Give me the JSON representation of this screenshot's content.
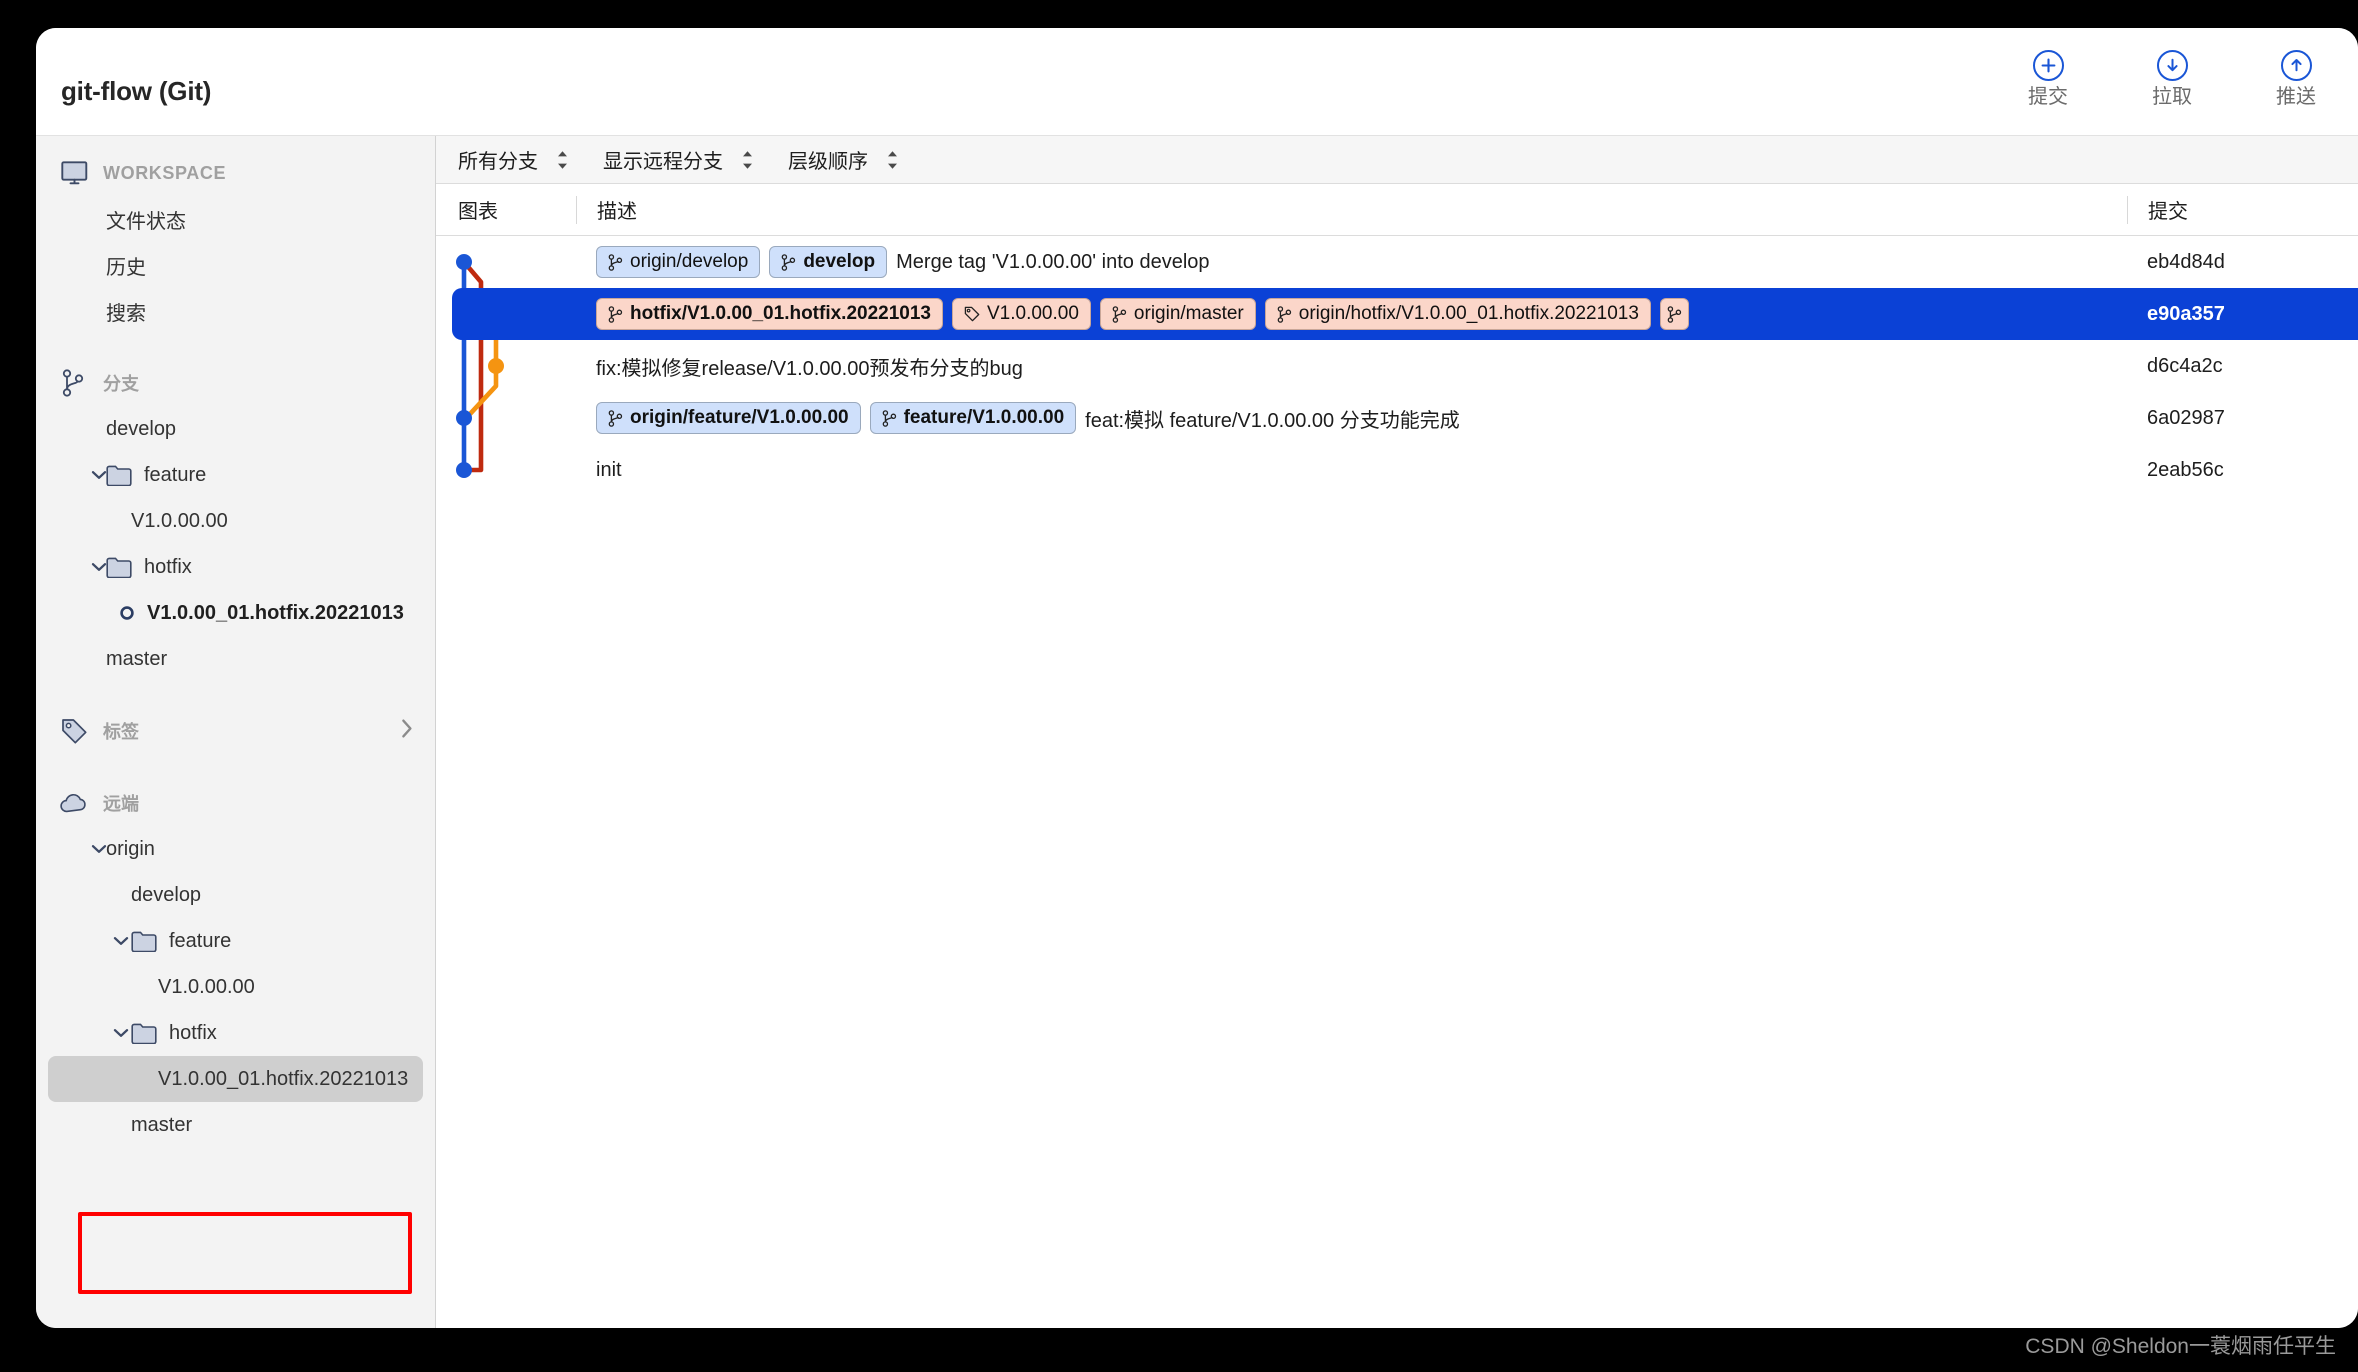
{
  "window": {
    "title": "git-flow (Git)"
  },
  "toolbar": {
    "buttons": [
      {
        "label": "提交",
        "icon": "plus-circle-icon"
      },
      {
        "label": "拉取",
        "icon": "download-circle-icon"
      },
      {
        "label": "推送",
        "icon": "upload-circle-icon"
      }
    ]
  },
  "sidebar": {
    "sections": [
      {
        "label": "WORKSPACE",
        "icon": "monitor-icon"
      },
      {
        "label": "分支",
        "icon": "branch-icon"
      },
      {
        "label": "标签",
        "icon": "tag-icon"
      },
      {
        "label": "远端",
        "icon": "cloud-icon"
      }
    ],
    "workspace_items": [
      {
        "label": "文件状态"
      },
      {
        "label": "历史"
      },
      {
        "label": "搜索"
      }
    ],
    "branches": [
      {
        "label": "develop",
        "type": "branch",
        "indent": 1
      },
      {
        "label": "feature",
        "type": "folder",
        "indent": 1,
        "twisty": "chevron-down-icon"
      },
      {
        "label": "V1.0.00.00",
        "type": "branch",
        "indent": 2
      },
      {
        "label": "hotfix",
        "type": "folder",
        "indent": 1,
        "twisty": "chevron-down-icon"
      },
      {
        "label": "V1.0.00_01.hotfix.20221013",
        "type": "current-branch",
        "indent": 2,
        "bold": true
      },
      {
        "label": "master",
        "type": "branch",
        "indent": 1
      }
    ],
    "remotes": [
      {
        "label": "origin",
        "type": "remote",
        "indent": 1,
        "twisty": "chevron-down-icon"
      },
      {
        "label": "develop",
        "type": "branch",
        "indent": 2
      },
      {
        "label": "feature",
        "type": "folder",
        "indent": 2,
        "twisty": "chevron-down-icon"
      },
      {
        "label": "V1.0.00.00",
        "type": "branch",
        "indent": 3
      },
      {
        "label": "hotfix",
        "type": "folder",
        "indent": 2,
        "twisty": "chevron-down-icon"
      },
      {
        "label": "V1.0.00_01.hotfix.20221013",
        "type": "branch",
        "indent": 3,
        "selected": true
      },
      {
        "label": "master",
        "type": "branch",
        "indent": 2
      }
    ],
    "highlight_color": "#ff0000"
  },
  "filterbar": {
    "items": [
      {
        "label": "所有分支"
      },
      {
        "label": "显示远程分支"
      },
      {
        "label": "层级顺序"
      }
    ]
  },
  "table": {
    "columns": {
      "graph": "图表",
      "description": "描述",
      "commit": "提交"
    },
    "rows": [
      {
        "badges": [
          {
            "text": "origin/develop",
            "kind": "blue",
            "icon": "branch-icon"
          },
          {
            "text": "develop",
            "kind": "blue",
            "icon": "branch-icon",
            "bold": true
          }
        ],
        "message": "Merge tag 'V1.0.00.00' into develop",
        "commit": "eb4d84d",
        "selected": false
      },
      {
        "badges": [
          {
            "text": "hotfix/V1.0.00_01.hotfix.20221013",
            "kind": "pink",
            "icon": "branch-icon",
            "bold": true
          },
          {
            "text": "V1.0.00.00",
            "kind": "pink",
            "icon": "tag-icon"
          },
          {
            "text": "origin/master",
            "kind": "pink",
            "icon": "branch-icon"
          },
          {
            "text": "origin/hotfix/V1.0.00_01.hotfix.20221013",
            "kind": "pink",
            "icon": "branch-icon"
          },
          {
            "text": "",
            "kind": "pink",
            "icon": "branch-icon"
          }
        ],
        "message": "",
        "commit": "e90a357",
        "selected": true
      },
      {
        "badges": [],
        "message": "fix:模拟修复release/V1.0.00.00预发布分支的bug",
        "commit": "d6c4a2c",
        "selected": false
      },
      {
        "badges": [
          {
            "text": "origin/feature/V1.0.00.00",
            "kind": "blue",
            "icon": "branch-icon",
            "bold": true
          },
          {
            "text": "feature/V1.0.00.00",
            "kind": "blue",
            "icon": "branch-icon",
            "bold": true
          }
        ],
        "message": "feat:模拟 feature/V1.0.00.00 分支功能完成",
        "commit": "6a02987",
        "selected": false
      },
      {
        "badges": [],
        "message": "init",
        "commit": "2eab56c",
        "selected": false
      }
    ]
  },
  "colors": {
    "selection": "#0b41d6",
    "graph_blue": "#1a56d6",
    "graph_red": "#bf2a0f",
    "graph_orange": "#f59411",
    "sidebar_bg": "#f3f3f3"
  },
  "watermark": "CSDN @Sheldon一蓑烟雨任平生"
}
